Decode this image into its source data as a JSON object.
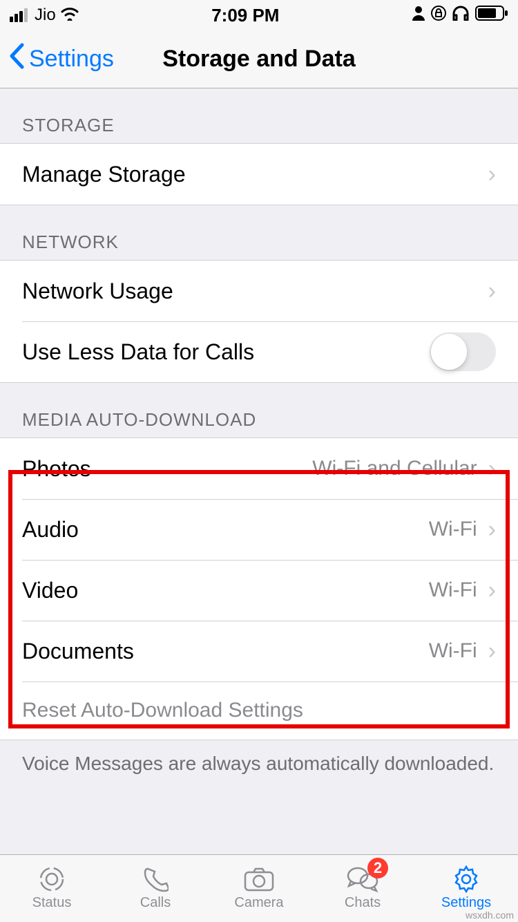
{
  "status": {
    "carrier": "Jio",
    "time": "7:09 PM"
  },
  "nav": {
    "back_label": "Settings",
    "title": "Storage and Data"
  },
  "sections": {
    "storage": {
      "header": "Storage",
      "manage_label": "Manage Storage"
    },
    "network": {
      "header": "Network",
      "usage_label": "Network Usage",
      "less_data_label": "Use Less Data for Calls",
      "less_data_on": false
    },
    "media": {
      "header": "Media Auto-Download",
      "photos_label": "Photos",
      "photos_value": "Wi-Fi and Cellular",
      "audio_label": "Audio",
      "audio_value": "Wi-Fi",
      "video_label": "Video",
      "video_value": "Wi-Fi",
      "documents_label": "Documents",
      "documents_value": "Wi-Fi",
      "reset_label": "Reset Auto-Download Settings",
      "footer_note": "Voice Messages are always automatically downloaded."
    }
  },
  "tabs": {
    "status": "Status",
    "calls": "Calls",
    "camera": "Camera",
    "chats": "Chats",
    "chats_badge": "2",
    "settings": "Settings"
  },
  "annotation": {
    "watermark": "wsxdh.com"
  }
}
